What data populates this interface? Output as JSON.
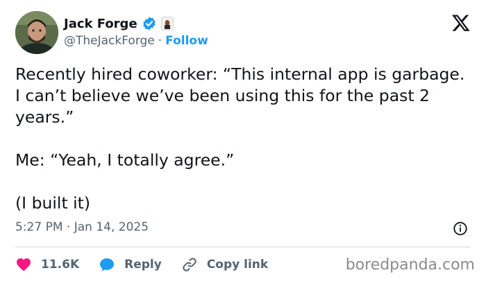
{
  "author": {
    "name": "Jack Forge",
    "handle": "@TheJackForge",
    "separator": "·",
    "follow_label": "Follow"
  },
  "tweet": {
    "paragraphs": [
      "Recently hired coworker: “This internal app is garbage. I can’t believe we’ve been using this for the past 2 years.”",
      "Me: “Yeah, I totally agree.”",
      "(I built it)"
    ],
    "timestamp": "5:27 PM · Jan 14, 2025"
  },
  "actions": {
    "likes_count": "11.6K",
    "reply_label": "Reply",
    "copy_link_label": "Copy link"
  },
  "watermark": "boredpanda.com",
  "colors": {
    "accent": "#1d9bf0",
    "like": "#f91880",
    "text": "#0f1419",
    "muted": "#536471"
  },
  "icons": [
    "verified-badge-icon",
    "affiliate-badge-icon",
    "x-logo-icon",
    "info-icon",
    "heart-icon",
    "reply-bubble-icon",
    "link-icon"
  ]
}
